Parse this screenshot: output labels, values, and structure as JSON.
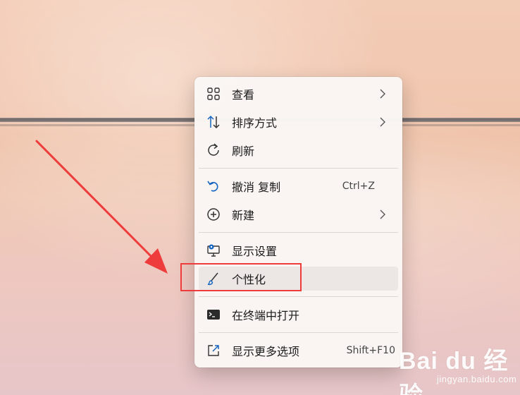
{
  "menu": {
    "items": [
      {
        "label": "查看",
        "icon": "grid-icon",
        "submenu": true
      },
      {
        "label": "排序方式",
        "icon": "sort-icon",
        "submenu": true
      },
      {
        "label": "刷新",
        "icon": "refresh-icon",
        "submenu": false
      },
      {
        "label": "撤消 复制",
        "icon": "undo-icon",
        "shortcut": "Ctrl+Z"
      },
      {
        "label": "新建",
        "icon": "add-circle-icon",
        "submenu": true
      },
      {
        "label": "显示设置",
        "icon": "display-settings-icon",
        "submenu": false
      },
      {
        "label": "个性化",
        "icon": "brush-icon",
        "submenu": false,
        "hovered": true
      },
      {
        "label": "在终端中打开",
        "icon": "terminal-icon",
        "submenu": false
      },
      {
        "label": "显示更多选项",
        "icon": "expand-icon",
        "shortcut": "Shift+F10"
      }
    ]
  },
  "annotation": {
    "arrow_color": "#ee3b3b",
    "highlight_color": "#ee3b3b",
    "highlighted_item": "个性化"
  },
  "watermark": {
    "brand": "Bai du 经验",
    "url": "jingyan.baidu.com"
  },
  "colors": {
    "accent_blue": "#1565c0",
    "menu_bg": "#faf6f4"
  }
}
